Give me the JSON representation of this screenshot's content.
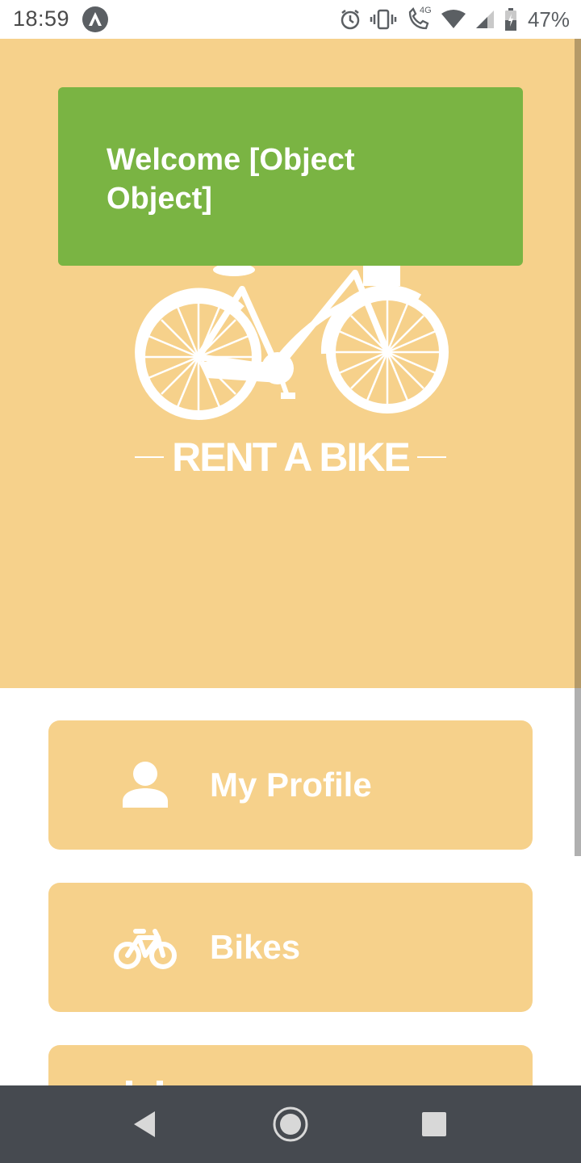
{
  "status_bar": {
    "time": "18:59",
    "network": "4G",
    "battery": "47%"
  },
  "hero": {
    "toast_message": "Welcome [Object Object]",
    "brand": "RENT A BIKE"
  },
  "menu": {
    "items": [
      {
        "label": "My Profile",
        "icon": "person-icon"
      },
      {
        "label": "Bikes",
        "icon": "bike-icon"
      },
      {
        "label": "",
        "icon": "partial-icon"
      }
    ]
  },
  "nav_bar": {
    "buttons": [
      "back",
      "home",
      "recents"
    ]
  },
  "colors": {
    "hero_bg": "#f6d18b",
    "toast_bg": "#7ab443",
    "card_bg": "#f6d18b",
    "nav_bg": "#464a50"
  }
}
